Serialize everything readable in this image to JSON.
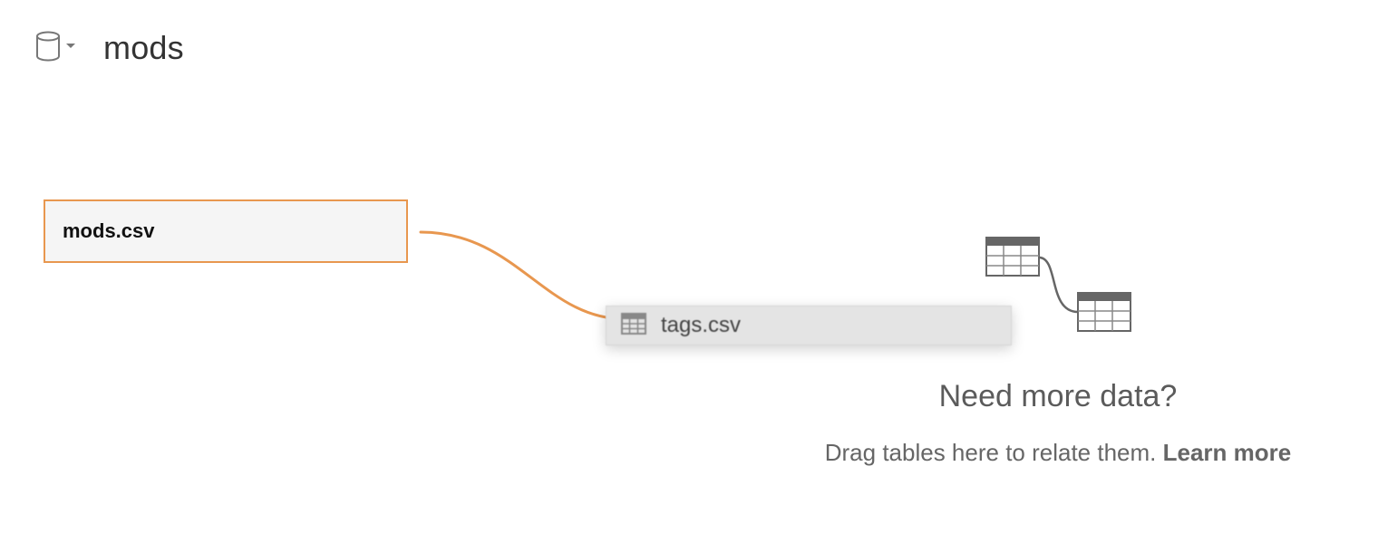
{
  "header": {
    "datasource_icon": "database-icon",
    "menu_icon": "caret-down-icon",
    "datasource_name": "mods"
  },
  "canvas": {
    "tables": [
      {
        "label": "mods.csv"
      }
    ],
    "dragging_table": {
      "icon": "table-grid-icon",
      "label": "tags.csv"
    },
    "relationship_color": "#e8974f",
    "empty_state": {
      "icon": "related-tables-icon",
      "title": "Need more data?",
      "hint": "Drag tables here to relate them.",
      "link": "Learn more"
    }
  }
}
